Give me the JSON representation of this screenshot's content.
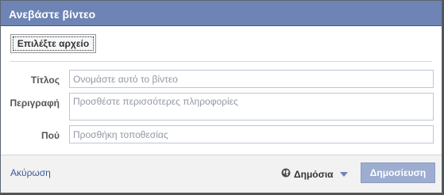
{
  "dialog": {
    "title": "Ανεβάστε βίντεο",
    "choose_file_label": "Επιλέξτε αρχείο"
  },
  "form": {
    "title_label": "Τίτλος",
    "title_placeholder": "Ονομάστε αυτό το βίντεο",
    "description_label": "Περιγραφή",
    "description_placeholder": "Προσθέστε περισσότερες πληροφορίες",
    "location_label": "Πού",
    "location_placeholder": "Προσθήκη τοποθεσίας"
  },
  "footer": {
    "cancel_label": "Ακύρωση",
    "privacy_label": "Δημόσια",
    "publish_label": "Δημοσίευση"
  },
  "colors": {
    "titlebar": "#6d84b4",
    "link": "#3b5998",
    "publish_disabled": "#9cadd0"
  },
  "icons": {
    "privacy": "globe-icon",
    "privacy_dropdown": "caret-down-icon"
  }
}
